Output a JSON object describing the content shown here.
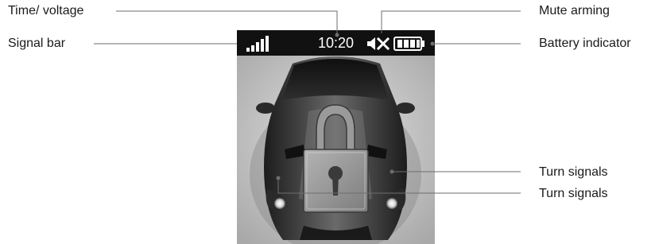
{
  "callouts": {
    "time_voltage": "Time/ voltage",
    "signal_bar": "Signal bar",
    "mute_arming": "Mute arming",
    "battery_indicator": "Battery indicator",
    "turn_signals_right": "Turn signals",
    "turn_signals_left": "Turn signals"
  },
  "status_bar": {
    "time": "10:20",
    "icons": [
      "signal-bars-icon",
      "mute-speaker-icon",
      "battery-icon"
    ]
  },
  "screen_image": {
    "icons": [
      "sports-car-top-view",
      "padlock-icon"
    ]
  },
  "colors": {
    "status_bar_bg": "#111111",
    "leader_line": "#6e6e6e",
    "label_text": "#1a1a1a"
  }
}
